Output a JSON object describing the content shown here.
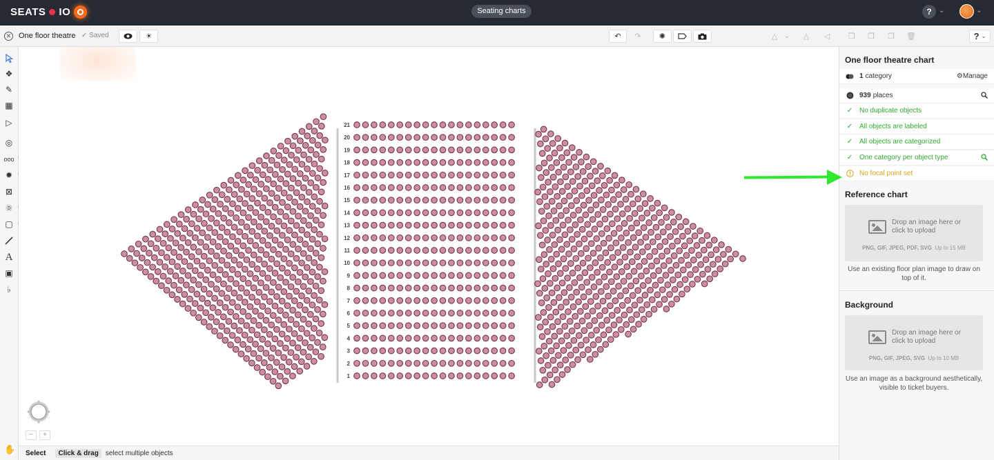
{
  "topbar": {
    "logo_left": "SEATS",
    "logo_right": "IO",
    "center_label": "Seating charts",
    "help_label": "?"
  },
  "toolbar": {
    "chart_name": "One floor theatre",
    "saved_label": "Saved",
    "help_label": "?"
  },
  "chart": {
    "rows": [
      "21",
      "20",
      "19",
      "18",
      "17",
      "16",
      "15",
      "14",
      "13",
      "12",
      "11",
      "10",
      "9",
      "8",
      "7",
      "6",
      "5",
      "4",
      "3",
      "2",
      "1"
    ],
    "seats_per_row": 19,
    "seat_fill": "#c98fa3",
    "seat_stroke": "#7a2f4a"
  },
  "statusbar": {
    "mode": "Select",
    "key": "Click & drag",
    "desc": "select multiple objects"
  },
  "panel": {
    "title": "One floor theatre chart",
    "categories": {
      "count": "1",
      "label": "category",
      "manage": "Manage"
    },
    "places": {
      "count": "939",
      "label": "places"
    },
    "checks": [
      {
        "label": "No duplicate objects",
        "status": "ok"
      },
      {
        "label": "All objects are labeled",
        "status": "ok"
      },
      {
        "label": "All objects are categorized",
        "status": "ok"
      },
      {
        "label": "One category per object type",
        "status": "ok"
      },
      {
        "label": "No focal point set",
        "status": "warn"
      }
    ],
    "reference": {
      "heading": "Reference chart",
      "drop_text": "Drop an image here or click to upload",
      "formats": "PNG, GIF, JPEG, PDF, SVG",
      "limit": "Up to 15 MB",
      "note": "Use an existing floor plan image to draw on top of it."
    },
    "background": {
      "heading": "Background",
      "drop_text": "Drop an image here or click to upload",
      "formats": "PNG, GIF, JPEG, SVG",
      "limit": "Up to 10 MB",
      "note": "Use an image as a background aesthetically, visible to ticket buyers."
    }
  },
  "colors": {
    "ok": "#2faa2f",
    "warn": "#d6a315",
    "annotation_arrow": "#2fe82f"
  }
}
